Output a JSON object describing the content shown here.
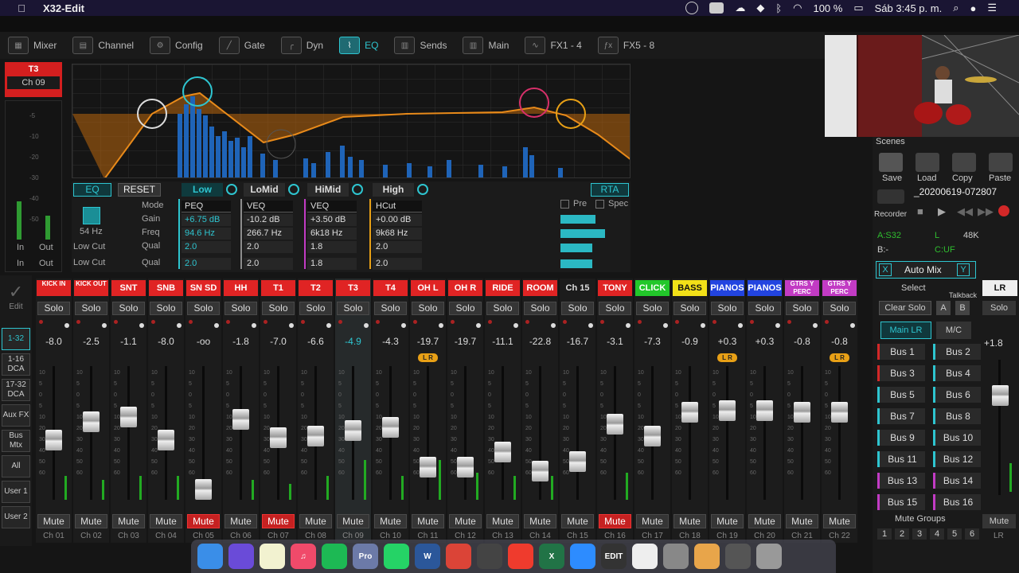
{
  "menubar": {
    "app": "X32-Edit",
    "battery": "100 %",
    "clock": "Sáb 3:45 p. m."
  },
  "tabs": [
    {
      "label": "Mixer"
    },
    {
      "label": "Channel"
    },
    {
      "label": "Config"
    },
    {
      "label": "Gate"
    },
    {
      "label": "Dyn"
    },
    {
      "label": "EQ"
    },
    {
      "label": "Sends"
    },
    {
      "label": "Main"
    },
    {
      "label": "FX1 - 4"
    },
    {
      "label": "FX5 - 8"
    }
  ],
  "channel": {
    "name": "T3",
    "ch": "Ch 09",
    "in": "In",
    "out": "Out",
    "scale": [
      "-5",
      "-10",
      "-20",
      "-30",
      "-40",
      "-50"
    ]
  },
  "eq": {
    "eq_btn": "EQ",
    "reset_btn": "RESET",
    "rta_btn": "RTA",
    "pre": "Pre",
    "spec": "Spec",
    "lowcut_freq": "54 Hz",
    "lowcut_label": "Low Cut",
    "lowcut_label2": "Low Cut",
    "row_labels": [
      "Mode",
      "Gain",
      "Freq",
      "Qual",
      "Qual"
    ],
    "bands": [
      {
        "name": "Low",
        "mode": "PEQ",
        "gain": "+6.75 dB",
        "freq": "94.6 Hz",
        "q": "2.0",
        "q2": "2.0"
      },
      {
        "name": "LoMid",
        "mode": "VEQ",
        "gain": "-10.2 dB",
        "freq": "266.7 Hz",
        "q": "2.0",
        "q2": "2.0"
      },
      {
        "name": "HiMid",
        "mode": "VEQ",
        "gain": "+3.50 dB",
        "freq": "6k18 Hz",
        "q": "1.8",
        "q2": "1.8"
      },
      {
        "name": "High",
        "mode": "HCut",
        "gain": "+0.00 dB",
        "freq": "9k68 Hz",
        "q": "2.0",
        "q2": "2.0"
      }
    ]
  },
  "right": {
    "scenes": "Scenes",
    "save": "Save",
    "load": "Load",
    "copy": "Copy",
    "paste": "Paste",
    "scene_name": "_20200619-072807",
    "recorder": "Recorder",
    "a": "A:S32",
    "l": "L",
    "rate": "48K",
    "b": "B:-",
    "c": "C:UF",
    "automix": "Auto Mix",
    "x": "X",
    "y": "Y",
    "select": "Select",
    "talkback": "Talkback",
    "clear_solo": "Clear Solo",
    "ta": "A",
    "tb": "B",
    "mainlr": "Main LR",
    "mc": "M/C",
    "buses": [
      "Bus 1",
      "Bus 2",
      "Bus 3",
      "Bus 4",
      "Bus 5",
      "Bus 6",
      "Bus 7",
      "Bus 8",
      "Bus 9",
      "Bus 10",
      "Bus 11",
      "Bus 12",
      "Bus 13",
      "Bus 14",
      "Bus 15",
      "Bus 16"
    ],
    "mute_groups": "Mute Groups",
    "mg_nums": [
      "1",
      "2",
      "3",
      "4",
      "5",
      "6"
    ],
    "lr": "LR",
    "lr_solo": "Solo",
    "lr_gain": "+1.8",
    "lr_mute": "Mute",
    "lr_label": "LR"
  },
  "nav": {
    "edit": "Edit",
    "items": [
      "1-32",
      "1-16 DCA",
      "17-32 DCA",
      "Aux FX",
      "Bus Mtx",
      "All",
      "User 1",
      "User 2"
    ]
  },
  "solo_label": "Solo",
  "mute_label": "Mute",
  "strips": [
    {
      "name": "KICK IN",
      "color": "#e02424",
      "text": "#fff",
      "gain": "-8.0",
      "fader": 0.44,
      "level": 0.18,
      "mute": false,
      "label": "Ch 01"
    },
    {
      "name": "KICK OUT",
      "color": "#e02424",
      "text": "#fff",
      "gain": "-2.5",
      "fader": 0.6,
      "level": 0.15,
      "mute": false,
      "label": "Ch 02"
    },
    {
      "name": "SNT",
      "color": "#e02424",
      "text": "#fff",
      "gain": "-1.1",
      "fader": 0.64,
      "level": 0.18,
      "mute": false,
      "label": "Ch 03"
    },
    {
      "name": "SNB",
      "color": "#e02424",
      "text": "#fff",
      "gain": "-8.0",
      "fader": 0.44,
      "level": 0.18,
      "mute": false,
      "label": "Ch 04"
    },
    {
      "name": "SN SD",
      "color": "#e02424",
      "text": "#fff",
      "gain": "-oo",
      "fader": 0.0,
      "level": 0.0,
      "mute": true,
      "label": "Ch 05"
    },
    {
      "name": "HH",
      "color": "#e02424",
      "text": "#fff",
      "gain": "-1.8",
      "fader": 0.62,
      "level": 0.15,
      "mute": false,
      "label": "Ch 06"
    },
    {
      "name": "T1",
      "color": "#e02424",
      "text": "#fff",
      "gain": "-7.0",
      "fader": 0.46,
      "level": 0.12,
      "mute": true,
      "label": "Ch 07"
    },
    {
      "name": "T2",
      "color": "#e02424",
      "text": "#fff",
      "gain": "-6.6",
      "fader": 0.47,
      "level": 0.18,
      "mute": false,
      "label": "Ch 08"
    },
    {
      "name": "T3",
      "color": "#e02424",
      "text": "#fff",
      "gain": "-4.9",
      "fader": 0.52,
      "level": 0.3,
      "mute": false,
      "label": "Ch 09",
      "sel": true
    },
    {
      "name": "T4",
      "color": "#e02424",
      "text": "#fff",
      "gain": "-4.3",
      "fader": 0.55,
      "level": 0.18,
      "mute": false,
      "label": "Ch 10"
    },
    {
      "name": "OH L",
      "color": "#e02424",
      "text": "#fff",
      "gain": "-19.7",
      "fader": 0.2,
      "level": 0.3,
      "mute": false,
      "label": "Ch 11",
      "lr": true
    },
    {
      "name": "OH R",
      "color": "#e02424",
      "text": "#fff",
      "gain": "-19.7",
      "fader": 0.2,
      "level": 0.2,
      "mute": false,
      "label": "Ch 12"
    },
    {
      "name": "RIDE",
      "color": "#e02424",
      "text": "#fff",
      "gain": "-11.1",
      "fader": 0.33,
      "level": 0.18,
      "mute": false,
      "label": "Ch 13"
    },
    {
      "name": "ROOM",
      "color": "#e02424",
      "text": "#fff",
      "gain": "-22.8",
      "fader": 0.16,
      "level": 0.18,
      "mute": false,
      "label": "Ch 14"
    },
    {
      "name": "Ch 15",
      "color": "#1c1c1c",
      "text": "#ddd",
      "gain": "-16.7",
      "fader": 0.25,
      "level": 0.0,
      "mute": false,
      "label": "Ch 15"
    },
    {
      "name": "TONY",
      "color": "#e02424",
      "text": "#fff",
      "gain": "-3.1",
      "fader": 0.58,
      "level": 0.2,
      "mute": true,
      "label": "Ch 16"
    },
    {
      "name": "CLICK",
      "color": "#22c72a",
      "text": "#fff",
      "gain": "-7.3",
      "fader": 0.47,
      "level": 0.0,
      "mute": false,
      "label": "Ch 17"
    },
    {
      "name": "BASS",
      "color": "#f2e018",
      "text": "#111",
      "gain": "-0.9",
      "fader": 0.68,
      "level": 0.0,
      "mute": false,
      "label": "Ch 18"
    },
    {
      "name": "PIANOS",
      "color": "#2244e0",
      "text": "#fff",
      "gain": "+0.3",
      "fader": 0.7,
      "level": 0.0,
      "mute": false,
      "label": "Ch 19",
      "lr": true
    },
    {
      "name": "PIANOS",
      "color": "#2244e0",
      "text": "#fff",
      "gain": "+0.3",
      "fader": 0.7,
      "level": 0.0,
      "mute": false,
      "label": "Ch 20"
    },
    {
      "name": "GTRS Y PERC",
      "color": "#c23bc4",
      "text": "#fff",
      "gain": "-0.8",
      "fader": 0.68,
      "level": 0.0,
      "mute": false,
      "label": "Ch 21"
    },
    {
      "name": "GTRS Y PERC",
      "color": "#c23bc4",
      "text": "#fff",
      "gain": "-0.8",
      "fader": 0.68,
      "level": 0.0,
      "mute": false,
      "label": "Ch 22",
      "lr": true
    }
  ],
  "dock": [
    {
      "icon": "finder-icon",
      "color": "#3a8ee8",
      "txt": ""
    },
    {
      "icon": "siri-icon",
      "color": "#6a4bd8",
      "txt": ""
    },
    {
      "icon": "notes-icon",
      "color": "#f2f2d0",
      "txt": ""
    },
    {
      "icon": "music-icon",
      "color": "#f04a6a",
      "txt": "♫"
    },
    {
      "icon": "spotify-icon",
      "color": "#1db954",
      "txt": ""
    },
    {
      "icon": "propresenter-icon",
      "color": "#6c7aa8",
      "txt": "Pro"
    },
    {
      "icon": "whatsapp-icon",
      "color": "#25d366",
      "txt": ""
    },
    {
      "icon": "word-icon",
      "color": "#2b579a",
      "txt": "W"
    },
    {
      "icon": "chrome-icon",
      "color": "#db4437",
      "txt": ""
    },
    {
      "icon": "finalcut-icon",
      "color": "#444",
      "txt": ""
    },
    {
      "icon": "anydesk-icon",
      "color": "#ef3b2d",
      "txt": ""
    },
    {
      "icon": "excel-icon",
      "color": "#217346",
      "txt": "X"
    },
    {
      "icon": "zoom-icon",
      "color": "#2d8cff",
      "txt": ""
    },
    {
      "icon": "x32edit-icon",
      "color": "#333",
      "txt": "EDIT"
    },
    {
      "icon": "pinterest-icon",
      "color": "#eee",
      "txt": ""
    },
    {
      "icon": "preview-icon",
      "color": "#888",
      "txt": ""
    },
    {
      "icon": "folder-icon",
      "color": "#e8a54a",
      "txt": ""
    },
    {
      "icon": "drive-icon",
      "color": "#555",
      "txt": ""
    },
    {
      "icon": "trash-icon",
      "color": "#999",
      "txt": ""
    }
  ]
}
